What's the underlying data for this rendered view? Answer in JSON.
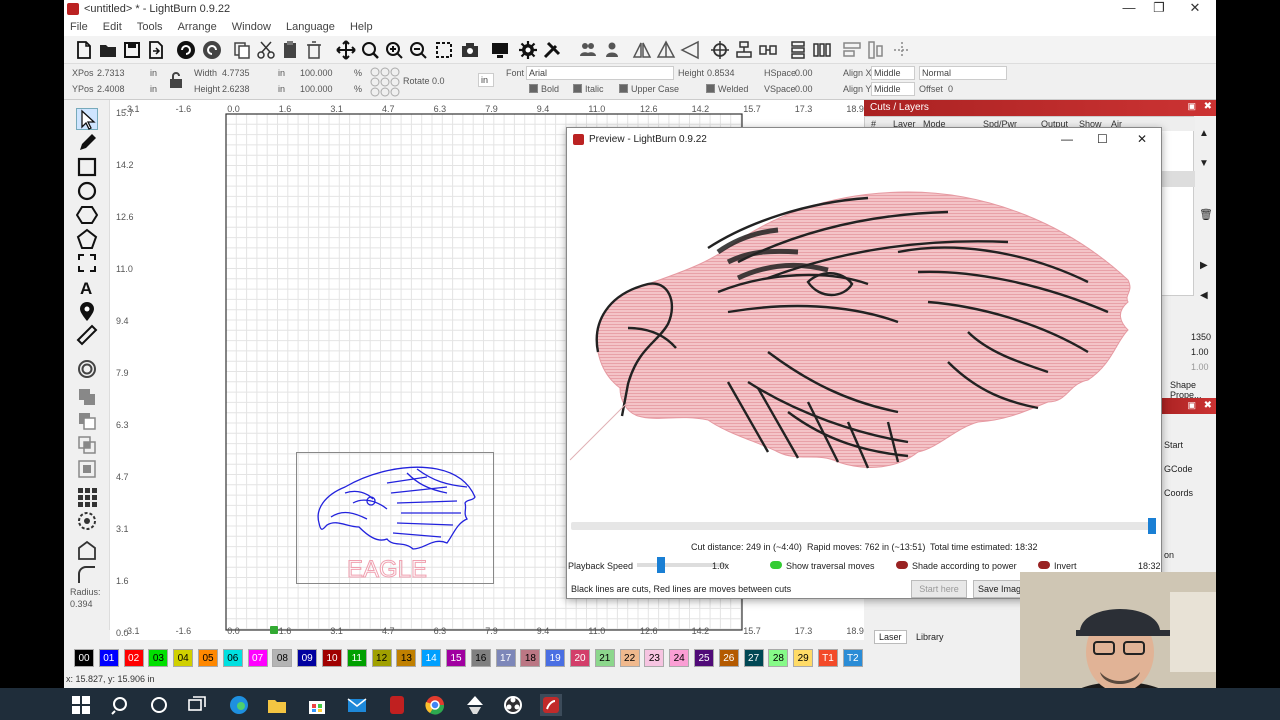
{
  "window": {
    "title": "<untitled> * - LightBurn 0.9.22",
    "minimize": "—",
    "maximize": "❐",
    "close": "✕"
  },
  "menu": [
    "File",
    "Edit",
    "Tools",
    "Arrange",
    "Window",
    "Language",
    "Help"
  ],
  "props": {
    "xpos_label": "XPos",
    "xpos": "2.7313",
    "ypos_label": "YPos",
    "ypos": "2.4008",
    "unit": "in",
    "width_label": "Width",
    "width": "4.7735",
    "height_label": "Height",
    "height": "2.6238",
    "scale_w": "100.000",
    "scale_h": "100.000",
    "pct": "%",
    "rotate_label": "Rotate",
    "rotate": "0.0",
    "in_button": "in",
    "font_label": "Font",
    "font": "Arial",
    "font_height_label": "Height",
    "font_height": "0.8534",
    "hspace_label": "HSpace",
    "hspace": "0.00",
    "vspace_label": "VSpace",
    "vspace": "0.00",
    "alignx_label": "Align X",
    "alignx": "Middle",
    "aligny_label": "Align Y",
    "aligny": "Middle",
    "normal": "Normal",
    "offset_label": "Offset",
    "offset": "0",
    "bold": "Bold",
    "italic": "Italic",
    "upper": "Upper Case",
    "welded": "Welded"
  },
  "ruler": {
    "x_top": [
      "-3.1",
      "-1.6",
      "0.0",
      "1.6",
      "3.1",
      "4.7",
      "6.3",
      "7.9",
      "9.4",
      "11.0",
      "12.6",
      "14.2",
      "15.7",
      "17.3",
      "18.9"
    ],
    "y_left": [
      "15.7",
      "14.2",
      "12.6",
      "11.0",
      "9.4",
      "7.9",
      "6.3",
      "4.7",
      "3.1",
      "1.6",
      "0.0"
    ]
  },
  "design": {
    "eagle_text": "EAGLE"
  },
  "radius": {
    "label": "Radius:",
    "value": "0.394"
  },
  "palette": [
    {
      "id": "00",
      "color": "#000000",
      "fg": "#ffffff"
    },
    {
      "id": "01",
      "color": "#0000ff",
      "fg": "#ffffff"
    },
    {
      "id": "02",
      "color": "#ff0000",
      "fg": "#ffffff"
    },
    {
      "id": "03",
      "color": "#00e000",
      "fg": "#000000"
    },
    {
      "id": "04",
      "color": "#d0d000",
      "fg": "#000000"
    },
    {
      "id": "05",
      "color": "#ff8800",
      "fg": "#000000"
    },
    {
      "id": "06",
      "color": "#00e0e0",
      "fg": "#000000"
    },
    {
      "id": "07",
      "color": "#ff00ff",
      "fg": "#ffffff"
    },
    {
      "id": "08",
      "color": "#b4b4b4",
      "fg": "#000000"
    },
    {
      "id": "09",
      "color": "#0000a0",
      "fg": "#ffffff"
    },
    {
      "id": "10",
      "color": "#a00000",
      "fg": "#ffffff"
    },
    {
      "id": "11",
      "color": "#00a000",
      "fg": "#ffffff"
    },
    {
      "id": "12",
      "color": "#a0a000",
      "fg": "#000000"
    },
    {
      "id": "13",
      "color": "#c08000",
      "fg": "#000000"
    },
    {
      "id": "14",
      "color": "#00a0ff",
      "fg": "#ffffff"
    },
    {
      "id": "15",
      "color": "#a000a0",
      "fg": "#ffffff"
    },
    {
      "id": "16",
      "color": "#808080",
      "fg": "#000000"
    },
    {
      "id": "17",
      "color": "#7d87b9",
      "fg": "#ffffff"
    },
    {
      "id": "18",
      "color": "#bb7784",
      "fg": "#000000"
    },
    {
      "id": "19",
      "color": "#4a6fe3",
      "fg": "#ffffff"
    },
    {
      "id": "20",
      "color": "#d33f6a",
      "fg": "#ffffff"
    },
    {
      "id": "21",
      "color": "#8cd78c",
      "fg": "#000000"
    },
    {
      "id": "22",
      "color": "#f0b98d",
      "fg": "#000000"
    },
    {
      "id": "23",
      "color": "#f6c4e1",
      "fg": "#000000"
    },
    {
      "id": "24",
      "color": "#fa9ed4",
      "fg": "#000000"
    },
    {
      "id": "25",
      "color": "#500a78",
      "fg": "#ffffff"
    },
    {
      "id": "26",
      "color": "#b45a00",
      "fg": "#ffffff"
    },
    {
      "id": "27",
      "color": "#004754",
      "fg": "#ffffff"
    },
    {
      "id": "28",
      "color": "#86fa88",
      "fg": "#000000"
    },
    {
      "id": "29",
      "color": "#ffdb66",
      "fg": "#000000"
    },
    {
      "id": "T1",
      "color": "#f34a29",
      "fg": "#ffffff"
    },
    {
      "id": "T2",
      "color": "#2a8cd6",
      "fg": "#ffffff"
    }
  ],
  "status": {
    "coords": "x: 15.827, y: 15.906 in"
  },
  "cuts_panel": {
    "title": "Cuts / Layers",
    "col_hash": "#",
    "col_layer": "Layer",
    "col_mode": "Mode",
    "col_spd": "Spd/Pwr",
    "col_output": "Output",
    "col_show": "Show",
    "col_air": "Air",
    "v1350": "1350",
    "v100": "1.00",
    "v100b": "1.00",
    "shape_props": "Shape Prope...",
    "start": "Start",
    "gcode": "GCode",
    "coords": "Coords",
    "on": "on",
    "tab_laser": "Laser",
    "tab_library": "Library"
  },
  "preview": {
    "title": "Preview - LightBurn 0.9.22",
    "cut_distance": "Cut distance: 249 in (~4:40)",
    "rapid_moves": "Rapid moves: 762 in (~13:51)",
    "total_time": "Total time estimated: 18:32",
    "playback_label": "Playback Speed",
    "speed": "1.0x",
    "show_traversal": "Show traversal moves",
    "shade": "Shade according to power",
    "invert": "Invert",
    "time_end": "18:32",
    "legend": "Black lines are cuts, Red lines are moves between cuts",
    "start_here": "Start here",
    "save_image": "Save Image",
    "progress": 1.0
  }
}
